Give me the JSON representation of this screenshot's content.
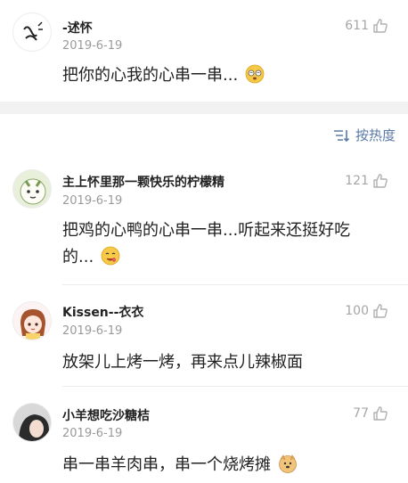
{
  "comments": [
    {
      "name": "-述怀",
      "date": "2019-6-19",
      "likes": "611",
      "text": "把你的心我的心串一串...",
      "emoji": "dizzy-face-emoji"
    },
    {
      "name": "主上怀里那一颗快乐的柠檬精",
      "date": "2019-6-19",
      "likes": "121",
      "text_line1": "把鸡的心鸭的心串一串...听起来还挺好吃",
      "text_line2": "的...",
      "emoji": "drooling-face-emoji"
    },
    {
      "name": "Kissen--衣衣",
      "date": "2019-6-19",
      "likes": "100",
      "text": "放架儿上烤一烤，再来点儿辣椒面"
    },
    {
      "name": "小羊想吃沙糖桔",
      "date": "2019-6-19",
      "likes": "77",
      "text": "串一串羊肉串，串一个烧烤摊",
      "emoji": "doge-emoji"
    }
  ],
  "sort": {
    "label": "按热度",
    "icon": "sort-icon"
  },
  "colors": {
    "link": "#5b7aa6",
    "meta": "#9a9a9a",
    "band": "#f2f2f2"
  }
}
